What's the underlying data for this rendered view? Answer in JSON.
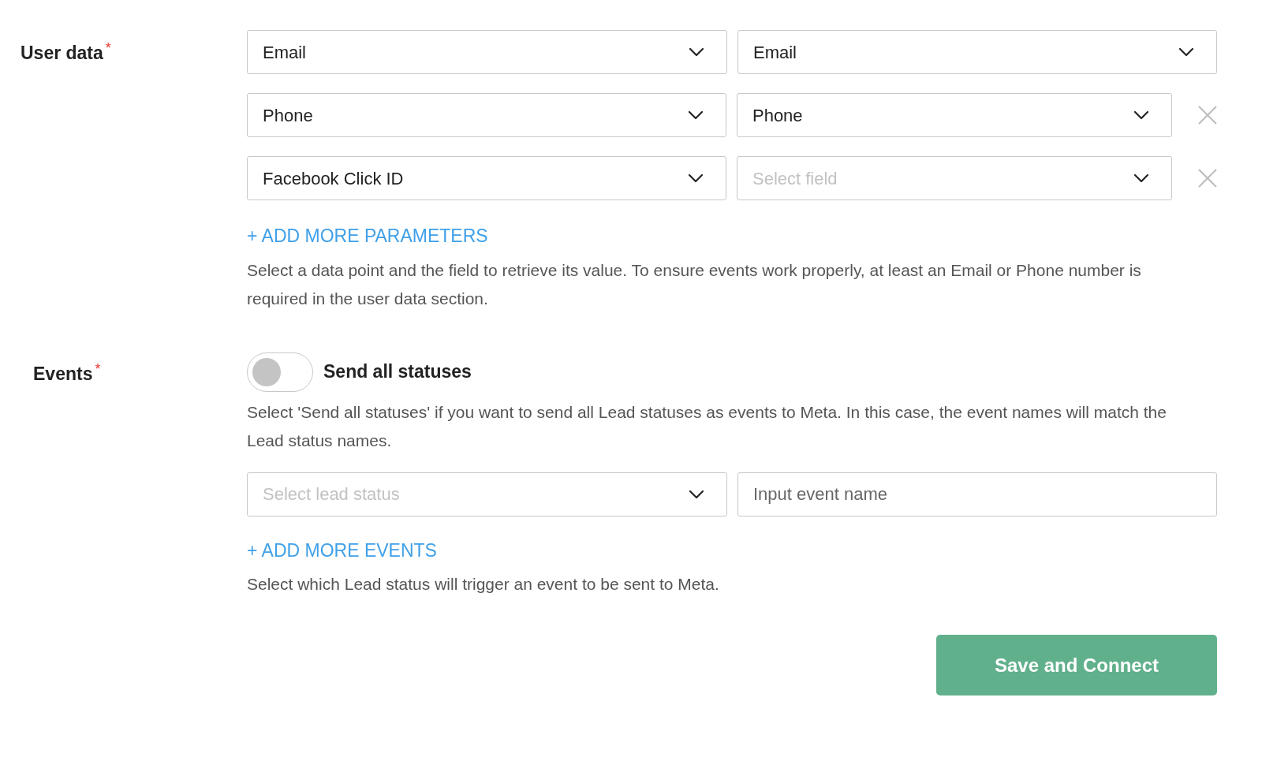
{
  "user_data": {
    "label": "User data",
    "required_mark": "*",
    "rows": [
      {
        "source": {
          "value": "Email"
        },
        "field": {
          "value": "Email"
        },
        "removable": false
      },
      {
        "source": {
          "value": "Phone"
        },
        "field": {
          "value": "Phone"
        },
        "removable": true
      },
      {
        "source": {
          "value": "Facebook Click ID"
        },
        "field": {
          "placeholder": "Select field"
        },
        "removable": true
      }
    ],
    "add_link": "+ ADD MORE PARAMETERS",
    "help": "Select a data point and the field to retrieve its value. To ensure events work properly, at least an Email or Phone number is required in the user data section."
  },
  "events": {
    "label": "Events",
    "required_mark": "*",
    "toggle": {
      "label": "Send all statuses",
      "on": false
    },
    "toggle_help": "Select 'Send all statuses' if you want to send all Lead statuses as events to Meta. In this case, the event names will match the Lead status names.",
    "rows": [
      {
        "status": {
          "placeholder": "Select lead status"
        },
        "event_name": {
          "placeholder": "Input event name"
        }
      }
    ],
    "add_link": "+ ADD MORE EVENTS",
    "help": "Select which Lead status will trigger an event to be sent to Meta."
  },
  "save_button": "Save and Connect"
}
